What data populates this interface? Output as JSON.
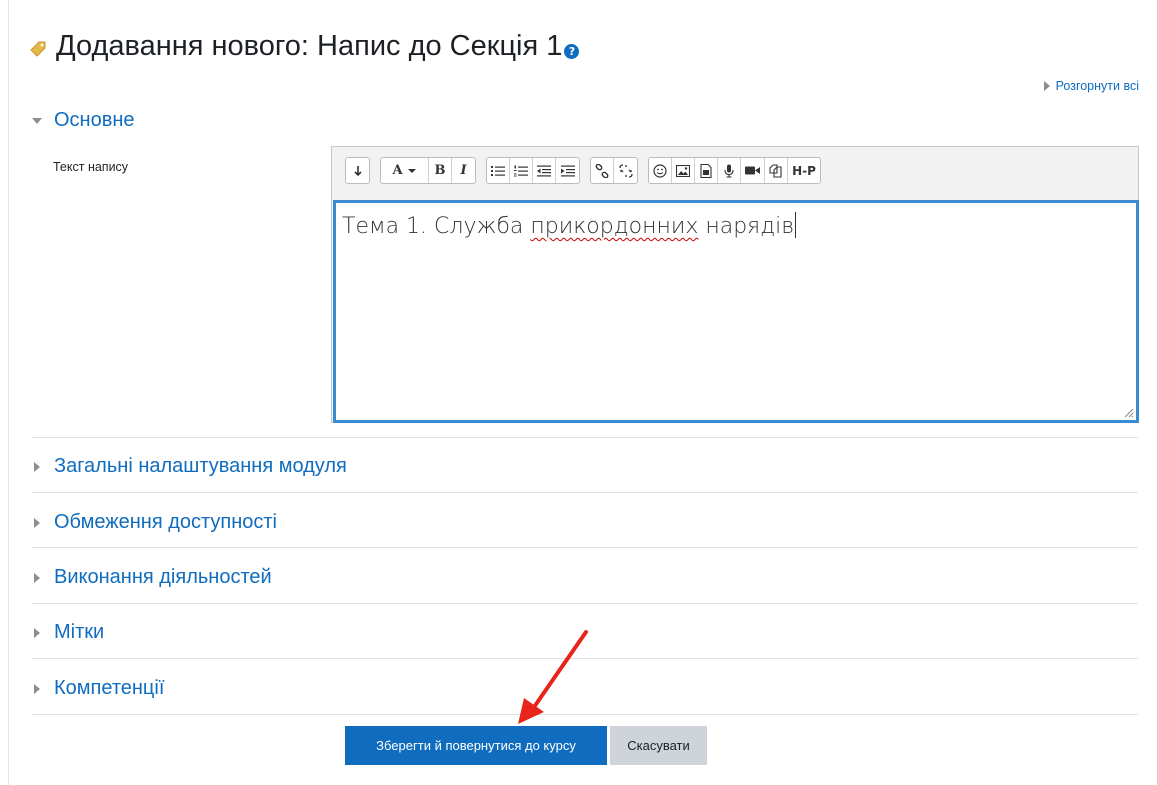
{
  "header": {
    "title": "Додавання нового: Напис до Секція 1",
    "title_icon": "tag-icon",
    "help_icon": "help-icon",
    "expand_all": "Розгорнути всі"
  },
  "sections": {
    "general": {
      "label": "Основне",
      "expanded": true
    },
    "collapsed": [
      {
        "label": "Загальні налаштування модуля"
      },
      {
        "label": "Обмеження доступності"
      },
      {
        "label": "Виконання діяльностей"
      },
      {
        "label": "Мітки"
      },
      {
        "label": "Компетенції"
      }
    ]
  },
  "field": {
    "label": "Текст напису",
    "value_before": "Тема 1. Служба ",
    "value_misspelled": "прикордонних",
    "value_after": " нарядів"
  },
  "toolbar": {
    "groups": [
      [
        "show-more-icon"
      ],
      [
        "font-style-icon",
        "bold-icon",
        "italic-icon"
      ],
      [
        "unordered-list-icon",
        "ordered-list-icon",
        "outdent-icon",
        "indent-icon"
      ],
      [
        "link-icon",
        "unlink-icon"
      ],
      [
        "emoji-icon",
        "image-icon",
        "media-icon",
        "record-audio-icon",
        "record-video-icon",
        "manage-files-icon",
        "h5p-icon"
      ]
    ],
    "font_style_label": "A",
    "bold_label": "B",
    "italic_label": "I",
    "h5p_label": "H-P"
  },
  "buttons": {
    "save_return": "Зберегти й повернутися до курсу",
    "cancel": "Скасувати"
  },
  "colors": {
    "link": "#0f6cbf",
    "primary_button": "#0f6cbf",
    "secondary_button": "#ced4da",
    "editor_focus": "#3c8bd1",
    "annotation_arrow": "#e8251a"
  }
}
